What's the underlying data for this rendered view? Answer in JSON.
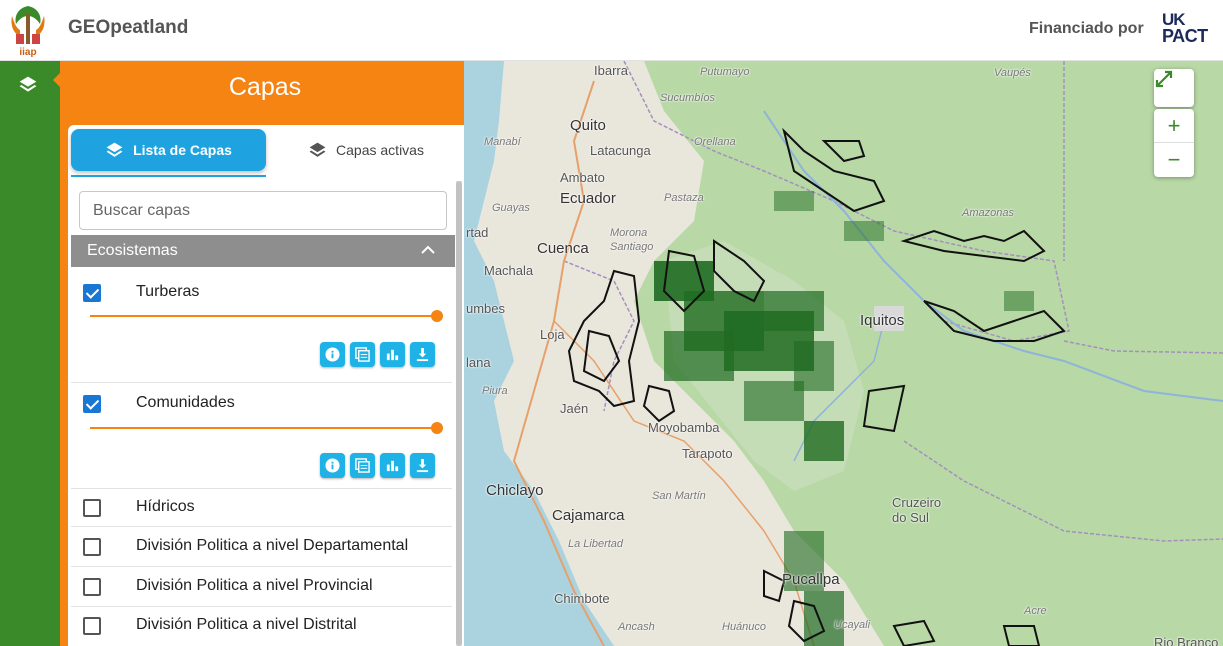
{
  "header": {
    "app_title": "GEOpeatland",
    "logo_text": "iiap",
    "funded_by": "Financiado por",
    "sponsor_uk": "UK",
    "sponsor_pact": "PACT"
  },
  "rail": {
    "layers_icon": "layers-icon"
  },
  "panel": {
    "title": "Capas",
    "tabs": [
      {
        "label": "Lista de Capas",
        "active": true,
        "icon": "layers-icon"
      },
      {
        "label": "Capas activas",
        "active": false,
        "icon": "layers-icon"
      }
    ],
    "search_placeholder": "Buscar capas",
    "section": {
      "label": "Ecosistemas",
      "expanded": true
    },
    "layers": [
      {
        "label": "Turberas",
        "checked": true,
        "opacity": 1.0
      },
      {
        "label": "Comunidades",
        "checked": true,
        "opacity": 1.0
      },
      {
        "label": "Hídricos",
        "checked": false
      },
      {
        "label": "División Politica a nivel Departamental",
        "checked": false
      },
      {
        "label": "División Politica a nivel Provincial",
        "checked": false
      },
      {
        "label": "División Politica a nivel Distrital",
        "checked": false
      }
    ],
    "layer_tools": [
      "info-icon",
      "legend-icon",
      "chart-icon",
      "download-icon"
    ]
  },
  "map": {
    "controls": {
      "fullscreen": "⤢",
      "zoom_in": "+",
      "zoom_out": "−"
    },
    "labels": {
      "ibarra": "Ibarra",
      "putumayo": "Putumayo",
      "vaupes": "Vaupés",
      "sucumbios": "Sucumbíos",
      "quito": "Quito",
      "manabi": "Manabí",
      "latacunga": "Latacunga",
      "orellana": "Orellana",
      "ambato": "Ambato",
      "pastaza": "Pastaza",
      "ecuador": "Ecuador",
      "guayas": "Guayas",
      "morona_santiago": "Morona\nSantiago",
      "amazonas": "Amazonas",
      "rtad": "rtad",
      "cuenca": "Cuenca",
      "machala": "Machala",
      "iquitos": "Iquitos",
      "umbes": "umbes",
      "loja": "Loja",
      "lana": "lana",
      "piura": "Piura",
      "jaen": "Jaén",
      "moyobamba": "Moyobamba",
      "tarapoto": "Tarapoto",
      "chiclayo": "Chiclayo",
      "san_martin": "San Martín",
      "cruzeiro": "Cruzeiro\ndo Sul",
      "cajamarca": "Cajamarca",
      "la_libertad": "La Libertad",
      "pucallpa": "Pucallpa",
      "chimbote": "Chimbote",
      "acre": "Acre",
      "ancash": "Ancash",
      "huanuco": "Huánuco",
      "ucayali": "Ucayali",
      "rio_branco": "Rio Branco"
    }
  }
}
